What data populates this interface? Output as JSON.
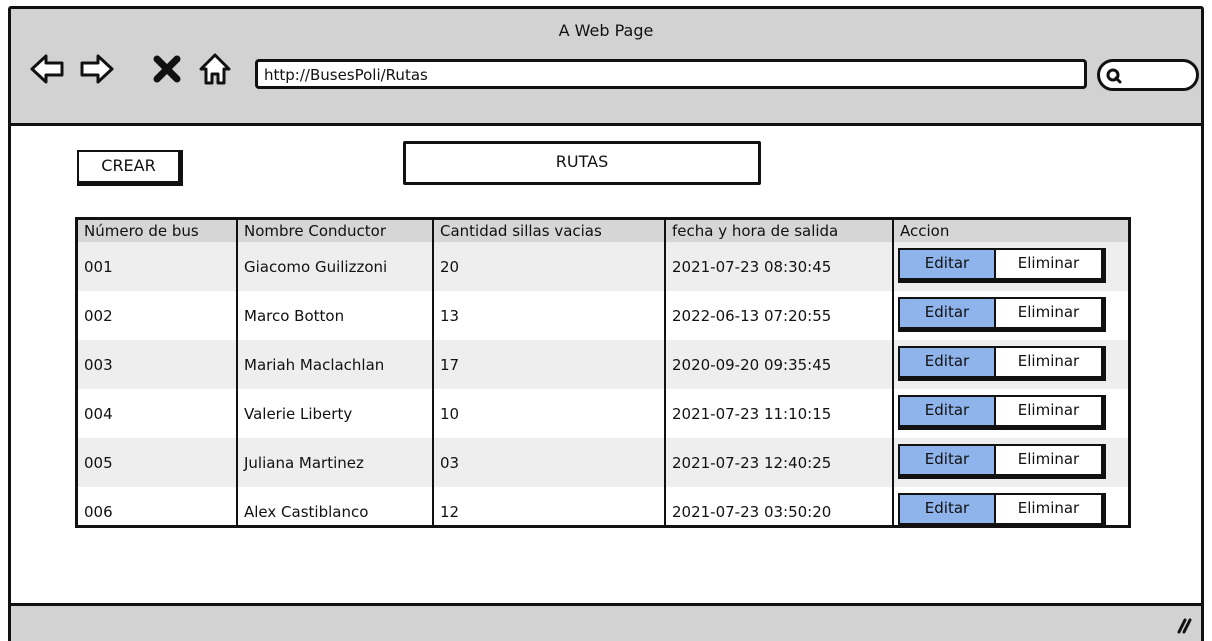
{
  "window": {
    "title": "A Web Page"
  },
  "browser": {
    "url": "http://BusesPoli/Rutas",
    "icons": [
      "back-arrow-icon",
      "forward-arrow-icon",
      "stop-icon",
      "home-icon",
      "search-icon"
    ]
  },
  "toolbar": {
    "create_label": "CREAR"
  },
  "page": {
    "title": "RUTAS"
  },
  "table": {
    "headers": [
      "Número de bus",
      "Nombre Conductor",
      "Cantidad sillas vacias",
      "fecha y hora de salida",
      "Accion"
    ],
    "rows": [
      {
        "bus": "001",
        "driver": "Giacomo Guilizzoni",
        "empty_seats": "20",
        "departure": "2021-07-23 08:30:45"
      },
      {
        "bus": "002",
        "driver": "Marco Botton",
        "empty_seats": "13",
        "departure": "2022-06-13 07:20:55"
      },
      {
        "bus": "003",
        "driver": "Mariah Maclachlan",
        "empty_seats": "17",
        "departure": "2020-09-20 09:35:45"
      },
      {
        "bus": "004",
        "driver": "Valerie Liberty",
        "empty_seats": "10",
        "departure": "2021-07-23 11:10:15"
      },
      {
        "bus": "005",
        "driver": "Juliana Martinez",
        "empty_seats": "03",
        "departure": "2021-07-23 12:40:25"
      },
      {
        "bus": "006",
        "driver": "Alex Castiblanco",
        "empty_seats": "12",
        "departure": "2021-07-23 03:50:20"
      }
    ],
    "actions": {
      "edit_label": "Editar",
      "delete_label": "Eliminar"
    }
  },
  "colors": {
    "chrome": "#d2d2d2",
    "edit_button": "#8fb4ec",
    "border": "#111111"
  }
}
